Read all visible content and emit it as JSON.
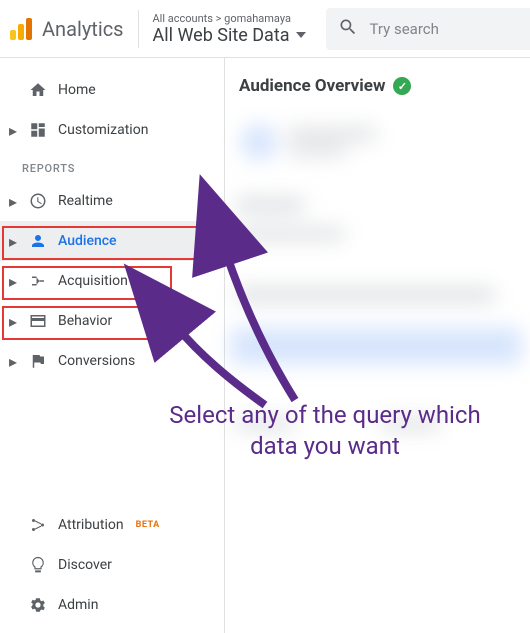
{
  "header": {
    "brand": "Analytics",
    "breadcrumb": "All accounts > gomahamaya",
    "view_name": "All Web Site Data"
  },
  "search": {
    "placeholder": "Try search"
  },
  "sidebar": {
    "home": "Home",
    "customization": "Customization",
    "reports_label": "REPORTS",
    "realtime": "Realtime",
    "audience": "Audience",
    "acquisition": "Acquisition",
    "behavior": "Behavior",
    "conversions": "Conversions",
    "attribution": "Attribution",
    "attribution_badge": "BETA",
    "discover": "Discover",
    "admin": "Admin"
  },
  "main": {
    "title": "Audience Overview"
  },
  "annotation": {
    "text": "Select any of the query which data you want"
  }
}
